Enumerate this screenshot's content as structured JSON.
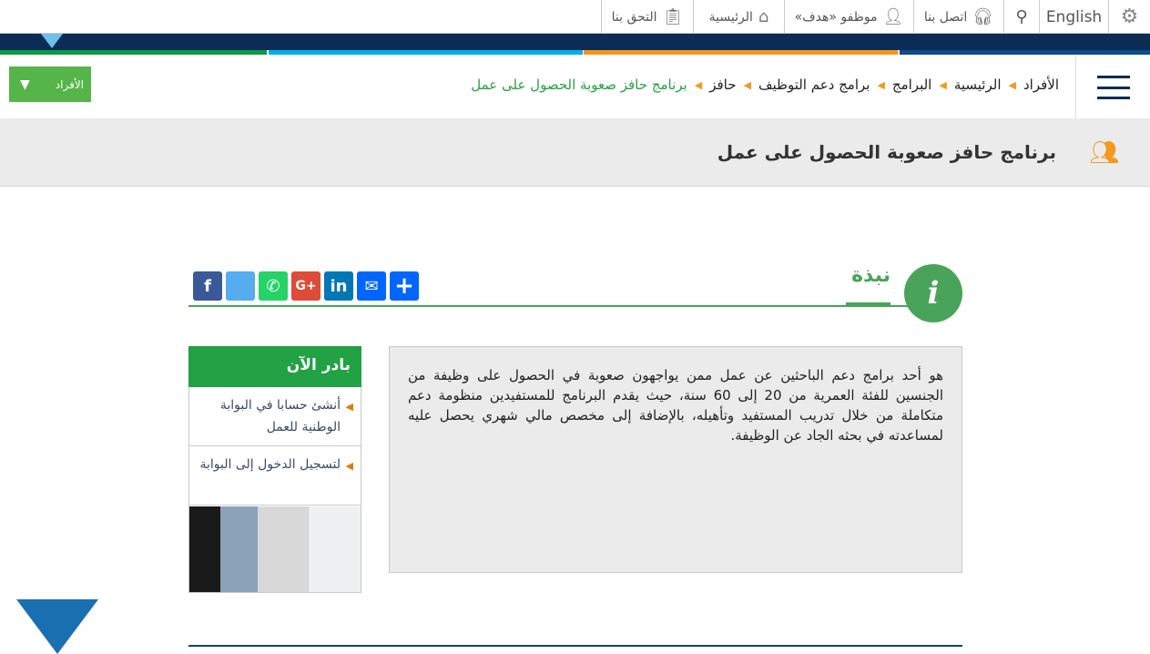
{
  "topbar": {
    "settings_icon": "gears-icon",
    "language": "English",
    "search_icon": "search-icon",
    "items": [
      {
        "label": "اتصل بنا",
        "icon": "headset-icon"
      },
      {
        "label": "موظفو «هدف»",
        "icon": "user-icon"
      },
      {
        "label": "الرئيسية",
        "icon": "home-icon"
      },
      {
        "label": "التحق بنا",
        "icon": "form-icon"
      }
    ]
  },
  "nav": {
    "menu_icon": "hamburger-icon",
    "dropdown": "الأفراد",
    "breadcrumb": [
      "الأفراد",
      "الرئيسية",
      "البرامج",
      "برامج دعم التوظيف",
      "حافز",
      "برنامج حافز صعوبة الحصول على عمل"
    ]
  },
  "page": {
    "title": "برنامج حافز صعوبة الحصول على عمل",
    "title_icon": "people-check-icon"
  },
  "section": {
    "heading": "نبذة",
    "icon": "info-icon",
    "share": [
      {
        "name": "facebook",
        "glyph": "f",
        "color": "#3b5998"
      },
      {
        "name": "twitter",
        "glyph": "t",
        "color": "#55acee"
      },
      {
        "name": "whatsapp",
        "glyph": "✆",
        "color": "#25d366"
      },
      {
        "name": "google-plus",
        "glyph": "G+",
        "color": "#dd4b39"
      },
      {
        "name": "linkedin",
        "glyph": "in",
        "color": "#0077b5"
      },
      {
        "name": "email",
        "glyph": "✉",
        "color": "#0166ff"
      },
      {
        "name": "more",
        "glyph": "+",
        "color": "#0166ff"
      }
    ],
    "body": "هو أحد برامج دعم الباحثين عن عمل ممن يواجهون صعوبة في الحصول على وظيفة من الجنسين للفئة العمرية من 20 إلى 60 سنة، حيث يقدم البرنامج للمستفيدين منظومة دعم متكاملة من خلال تدريب المستفيد وتأهيله، بالإضافة إلى مخصص مالي شهري يحصل عليه لمساعدته في بحثه الجاد عن الوظيفة."
  },
  "sidebar": {
    "title": "بادر الآن",
    "links": [
      "أنشئ حسابا في البوابة الوطنية للعمل",
      "لتسجيل الدخول إلى البوابة"
    ]
  },
  "colors": {
    "green": "#2aa046",
    "navy": "#0b2c55",
    "orange": "#f39a1e"
  }
}
